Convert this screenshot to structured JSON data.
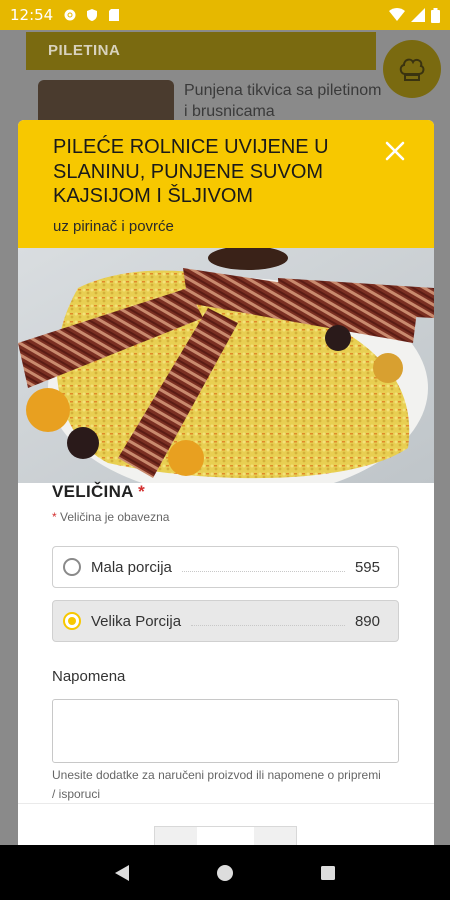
{
  "status_bar": {
    "time": "12:54"
  },
  "background": {
    "category": "PILETINA",
    "item_title": "Punjena tikvica sa piletinom i brusnicama"
  },
  "modal": {
    "title": "PILEĆE ROLNICE UVIJENE U SLANINU, PUNJENE SUVOM KAJSIJOM I ŠLJIVOM",
    "subtitle": "uz pirinač i povrće",
    "size_section": {
      "title": "VELIČINA",
      "required_mark": "*",
      "required_hint": "Veličina je obavezna",
      "options": [
        {
          "label": "Mala porcija",
          "price": "595",
          "selected": false
        },
        {
          "label": "Velika Porcija",
          "price": "890",
          "selected": true
        }
      ]
    },
    "note": {
      "label": "Napomena",
      "value": "",
      "hint": "Unesite dodatke za naručeni proizvod ili napomene o pripremi / isporuci"
    }
  },
  "colors": {
    "accent": "#f7c800",
    "status_bar": "#e6b800",
    "required": "#d32f2f"
  }
}
